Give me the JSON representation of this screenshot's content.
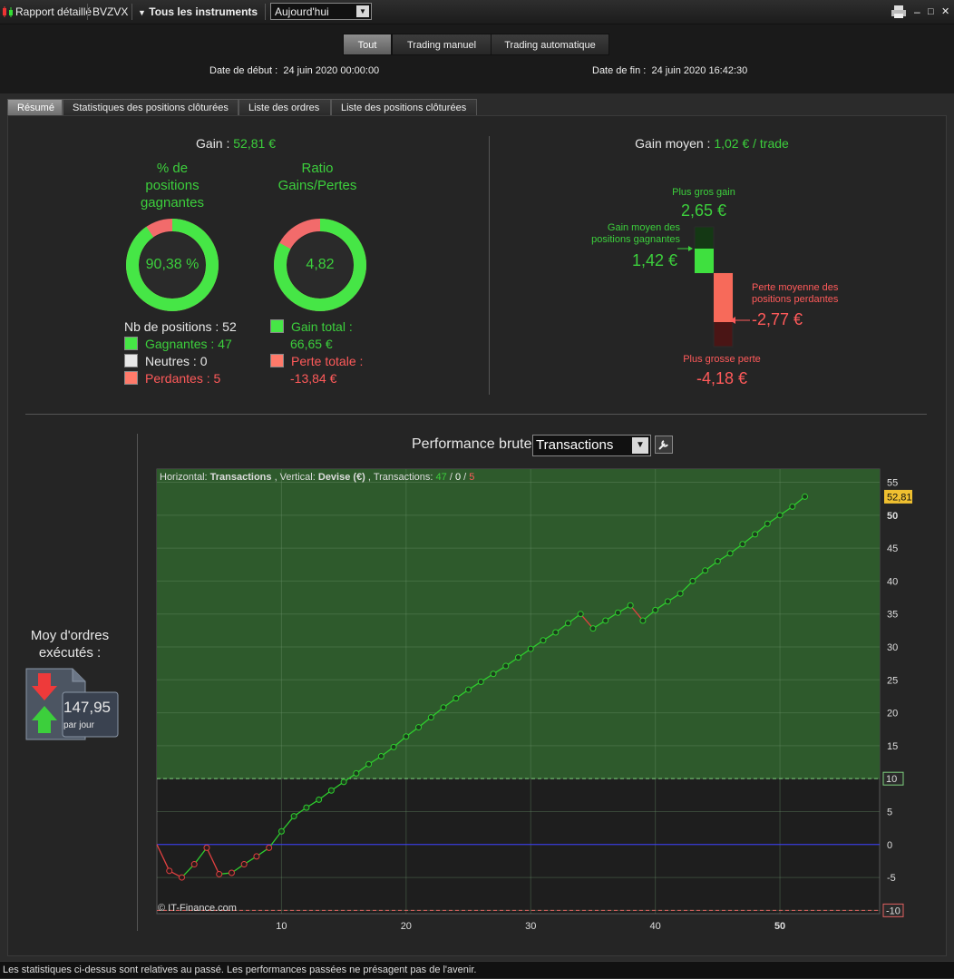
{
  "toolbar": {
    "report_label": "Rapport détaillé",
    "symbol": "BVZVX",
    "instruments_label": "Tous les instruments",
    "period": "Aujourd'hui",
    "window_min": "–",
    "window_max": "□",
    "window_close": "✕"
  },
  "filters": {
    "all": "Tout",
    "manual": "Trading manuel",
    "auto": "Trading automatique"
  },
  "dates": {
    "start_label": "Date de début :",
    "start_value": "24 juin 2020 00:00:00",
    "end_label": "Date de fin :",
    "end_value": "24 juin 2020 16:42:30"
  },
  "tabs": [
    "Résumé",
    "Statistiques des positions clôturées",
    "Liste des ordres",
    "Liste des positions clôturées"
  ],
  "summary": {
    "gain_label": "Gain :",
    "gain_value": "52,81 €",
    "winning_pct_title_1": "% de",
    "winning_pct_title_2": "positions",
    "winning_pct_title_3": "gagnantes",
    "winning_pct_value": "90,38 %",
    "winning_fraction": 0.9038,
    "ratio_title_1": "Ratio",
    "ratio_title_2": "Gains/Pertes",
    "ratio_value": "4,82",
    "ratio_fraction": 0.828,
    "nb_positions": "Nb de positions : 52",
    "winners": "Gagnantes : 47",
    "neutral": "Neutres : 0",
    "losers": "Perdantes : 5",
    "total_gain_label": "Gain total :",
    "total_gain_value": "66,65 €",
    "total_loss_label": "Perte totale :",
    "total_loss_value": "-13,84 €"
  },
  "average": {
    "title_label": "Gain moyen :",
    "title_value": "1,02 € / trade",
    "max_gain_label": "Plus gros gain",
    "max_gain_value": "2,65 €",
    "avg_win_label_1": "Gain moyen des",
    "avg_win_label_2": "positions gagnantes",
    "avg_win_value": "1,42 €",
    "avg_loss_label_1": "Perte moyenne des",
    "avg_loss_label_2": "positions perdantes",
    "avg_loss_value": "-2,77 €",
    "max_loss_label": "Plus grosse perte",
    "max_loss_value": "-4,18 €"
  },
  "orders": {
    "title_1": "Moy d'ordres",
    "title_2": "exécutés :",
    "value": "147,95",
    "unit": "par jour"
  },
  "performance": {
    "label": "Performance brute",
    "select_value": "Transactions",
    "info_horizontal": "Horizontal:",
    "info_h_value": "Transactions",
    "info_vertical": ", Vertical:",
    "info_v_value": "Devise (€)",
    "info_tx": ", Transactions:",
    "info_win": "47",
    "info_slash1": " / ",
    "info_neutral": "0",
    "info_slash2": " / ",
    "info_loss": "5",
    "copyright": "© IT-Finance.com",
    "last_value_badge": "52,81"
  },
  "chart_data": {
    "type": "line",
    "xlabel": "",
    "ylabel": "",
    "xlim": [
      0,
      58
    ],
    "ylim": [
      -10.5,
      57
    ],
    "x_ticks": [
      10,
      20,
      30,
      40,
      50
    ],
    "y_ticks": [
      -10,
      -5,
      0,
      5,
      10,
      15,
      20,
      25,
      30,
      35,
      40,
      45,
      50,
      55
    ],
    "highlight_levels": [
      10,
      -10
    ],
    "green_zone_above": 10,
    "x": [
      0,
      1,
      2,
      3,
      4,
      5,
      6,
      7,
      8,
      9,
      10,
      11,
      12,
      13,
      14,
      15,
      16,
      17,
      18,
      19,
      20,
      21,
      22,
      23,
      24,
      25,
      26,
      27,
      28,
      29,
      30,
      31,
      32,
      33,
      34,
      35,
      36,
      37,
      38,
      39,
      40,
      41,
      42,
      43,
      44,
      45,
      46,
      47,
      48,
      49,
      50,
      51,
      52
    ],
    "values": [
      0,
      -4,
      -5,
      -3,
      -0.5,
      -4.5,
      -4.3,
      -3,
      -1.8,
      -0.5,
      2,
      4.3,
      5.6,
      6.8,
      8.2,
      9.5,
      10.8,
      12.2,
      13.4,
      14.8,
      16.4,
      17.8,
      19.3,
      20.8,
      22.2,
      23.5,
      24.7,
      25.9,
      27.1,
      28.4,
      29.7,
      31.0,
      32.2,
      33.6,
      35.0,
      32.8,
      34.0,
      35.2,
      36.3,
      34.0,
      35.6,
      36.9,
      38.1,
      40.0,
      41.6,
      43.0,
      44.2,
      45.6,
      47.1,
      48.7,
      50.0,
      51.3,
      52.81
    ],
    "colors": {
      "win": "#2ecc2e",
      "loss": "#e04040",
      "zero_line": "#3a3aff"
    }
  },
  "footer": "Les statistiques ci-dessus sont relatives au passé. Les performances passées ne présagent pas de l'avenir.",
  "colors": {
    "positive": "#3ccf3c",
    "negative": "#ff5a5a",
    "badge": "#f0c030"
  }
}
